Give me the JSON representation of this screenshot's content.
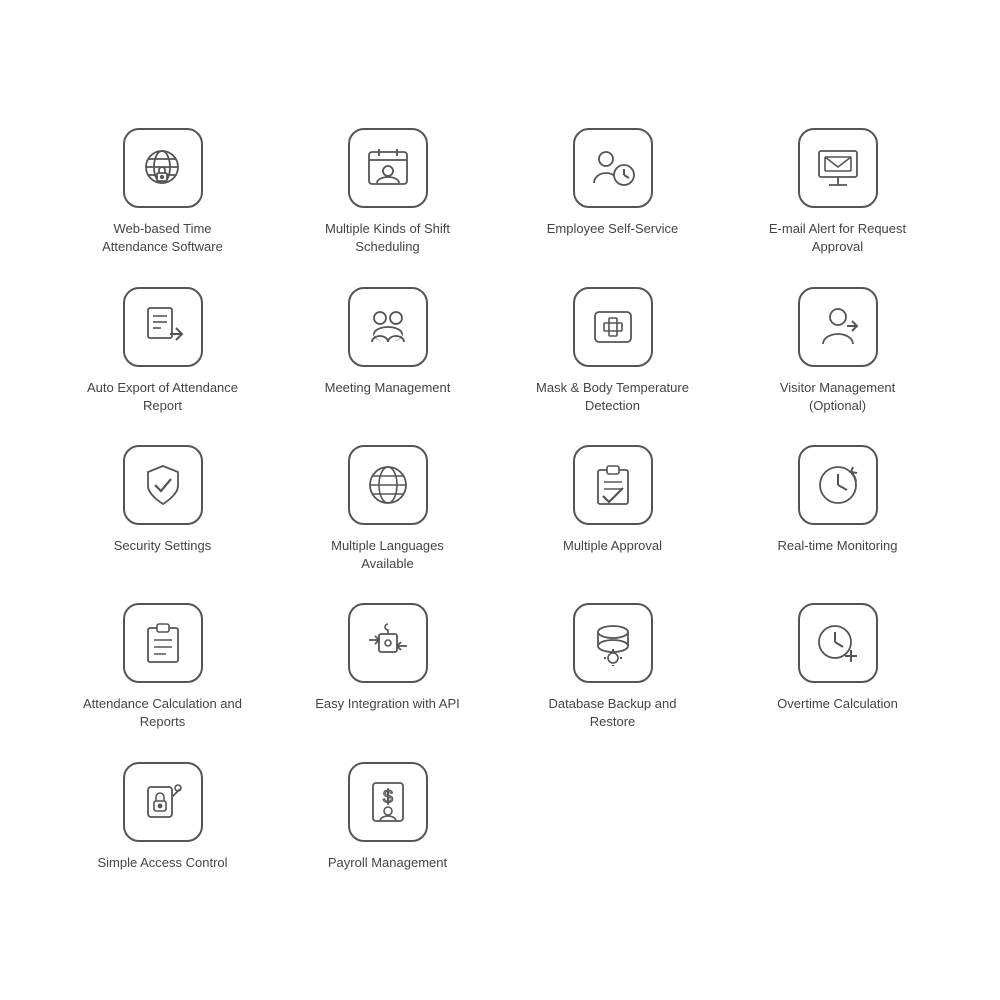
{
  "features": [
    {
      "id": "web-based-time",
      "label": "Web-based Time Attendance Software",
      "icon": "globe-lock"
    },
    {
      "id": "shift-scheduling",
      "label": "Multiple Kinds of Shift Scheduling",
      "icon": "calendar-user"
    },
    {
      "id": "self-service",
      "label": "Employee Self-Service",
      "icon": "person-clock"
    },
    {
      "id": "email-alert",
      "label": "E-mail Alert for Request Approval",
      "icon": "email-monitor"
    },
    {
      "id": "auto-export",
      "label": "Auto Export of Attendance Report",
      "icon": "export-doc"
    },
    {
      "id": "meeting-mgmt",
      "label": "Meeting Management",
      "icon": "meeting"
    },
    {
      "id": "mask-temp",
      "label": "Mask & Body Temperature Detection",
      "icon": "first-aid-face"
    },
    {
      "id": "visitor-mgmt",
      "label": "Visitor Management (Optional)",
      "icon": "visitor"
    },
    {
      "id": "security",
      "label": "Security Settings",
      "icon": "shield-check"
    },
    {
      "id": "multi-lang",
      "label": "Multiple Languages Available",
      "icon": "globe-gear"
    },
    {
      "id": "multi-approval",
      "label": "Multiple Approval",
      "icon": "checklist-check"
    },
    {
      "id": "realtime-mon",
      "label": "Real-time Monitoring",
      "icon": "clock-arrow"
    },
    {
      "id": "attendance-calc",
      "label": "Attendance Calculation and Reports",
      "icon": "clipboard-list"
    },
    {
      "id": "easy-integration",
      "label": "Easy Integration with API",
      "icon": "puzzle-arrows"
    },
    {
      "id": "db-backup",
      "label": "Database Backup and Restore",
      "icon": "database-gear"
    },
    {
      "id": "overtime",
      "label": "Overtime Calculation",
      "icon": "clock-plus"
    },
    {
      "id": "access-control",
      "label": "Simple Access Control",
      "icon": "key-card"
    },
    {
      "id": "payroll",
      "label": "Payroll Management",
      "icon": "dollar-person"
    }
  ]
}
